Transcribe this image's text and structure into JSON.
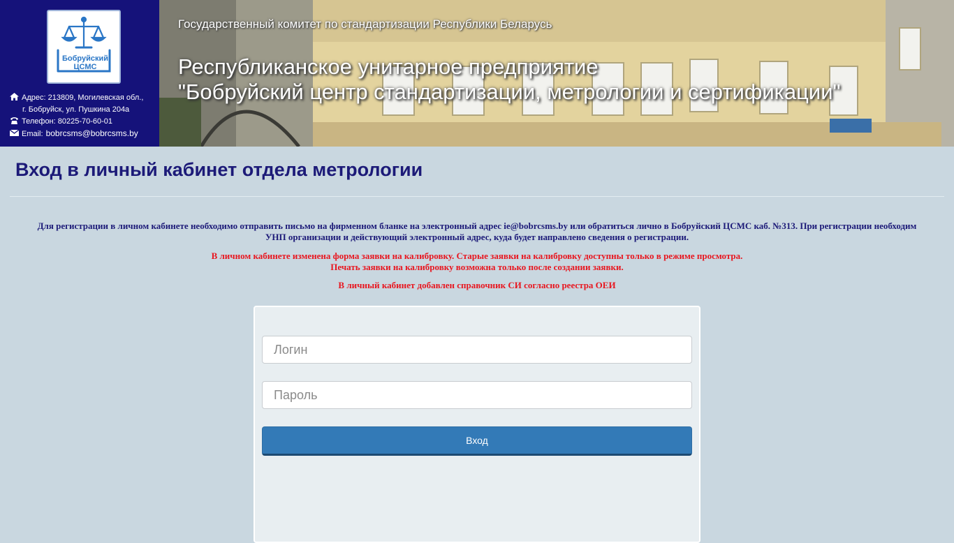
{
  "sidebar": {
    "logo_text": "Бобруйский ЦСМС",
    "address_line1": "Адрес: 213809, Могилевская обл.,",
    "address_line2": "г. Бобруйск, ул. Пушкина 204а",
    "phone": "Телефон: 80225-70-60-01",
    "email_label": "Email:",
    "email_value": "bobrcsms@bobrcsms.by"
  },
  "banner": {
    "gov_name": "Государственный комитет по стандартизации Республики Беларусь",
    "org_line1": "Республиканское унитарное предприятие",
    "org_line2": "\"Бобруйский центр стандартизации, метрологии и сертификации\""
  },
  "main": {
    "title": "Вход в личный кабинет отдела метрологии",
    "registration_info": "Для регистрации в личном кабинете необходимо отправить письмо на фирменном бланке на электронный адрес ie@bobrcsms.by или обратиться лично в Бобруйский ЦСМС каб. №313. При регистрации необходим УНП организации и действующий электронный адрес, куда будет направлено сведения о регистрации.",
    "notice_form_changed": "В личном кабинете изменена форма заявки на калибровку. Старые заявки на калибровку доступны только в режиме просмотра.",
    "notice_print": "Печать заявки на калибровку возможна только после создании заявки.",
    "notice_directory": "В личный кабинет добавлен справочник СИ согласно реестра ОЕИ"
  },
  "login_form": {
    "login_placeholder": "Логин",
    "password_placeholder": "Пароль",
    "submit_label": "Вход"
  },
  "colors": {
    "sidebar_bg": "#15127a",
    "page_bg": "#c9d7e0",
    "title": "#1c1a78",
    "notice_red": "#e8161f",
    "button": "#337ab7"
  }
}
